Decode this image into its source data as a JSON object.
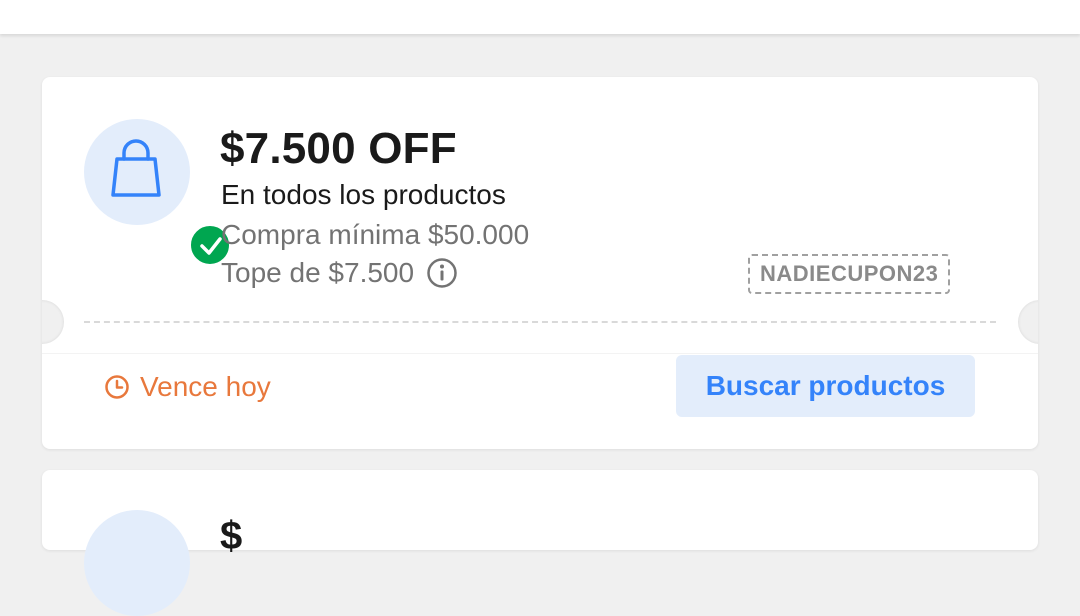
{
  "coupon": {
    "icon": "shopping-bag-icon",
    "status_icon": "check-circle-icon",
    "amount": "$7.500 OFF",
    "scope": "En todos los productos",
    "minimum_purchase": "Compra mínima $50.000",
    "cap": "Tope de $7.500",
    "cap_info_icon": "info-icon",
    "code": "NADIECUPON23",
    "expiry": "Vence hoy",
    "expiry_icon": "clock-icon",
    "action_label": "Buscar productos"
  },
  "next_coupon": {
    "amount_peek": "$"
  },
  "colors": {
    "background": "#f0f0f0",
    "accent_blue": "#3483fa",
    "accent_blue_light": "#e3edfb",
    "success_green": "#00a650",
    "expiry_orange": "#e8783c",
    "text_primary": "#1a1a1a",
    "text_secondary": "#737373"
  }
}
